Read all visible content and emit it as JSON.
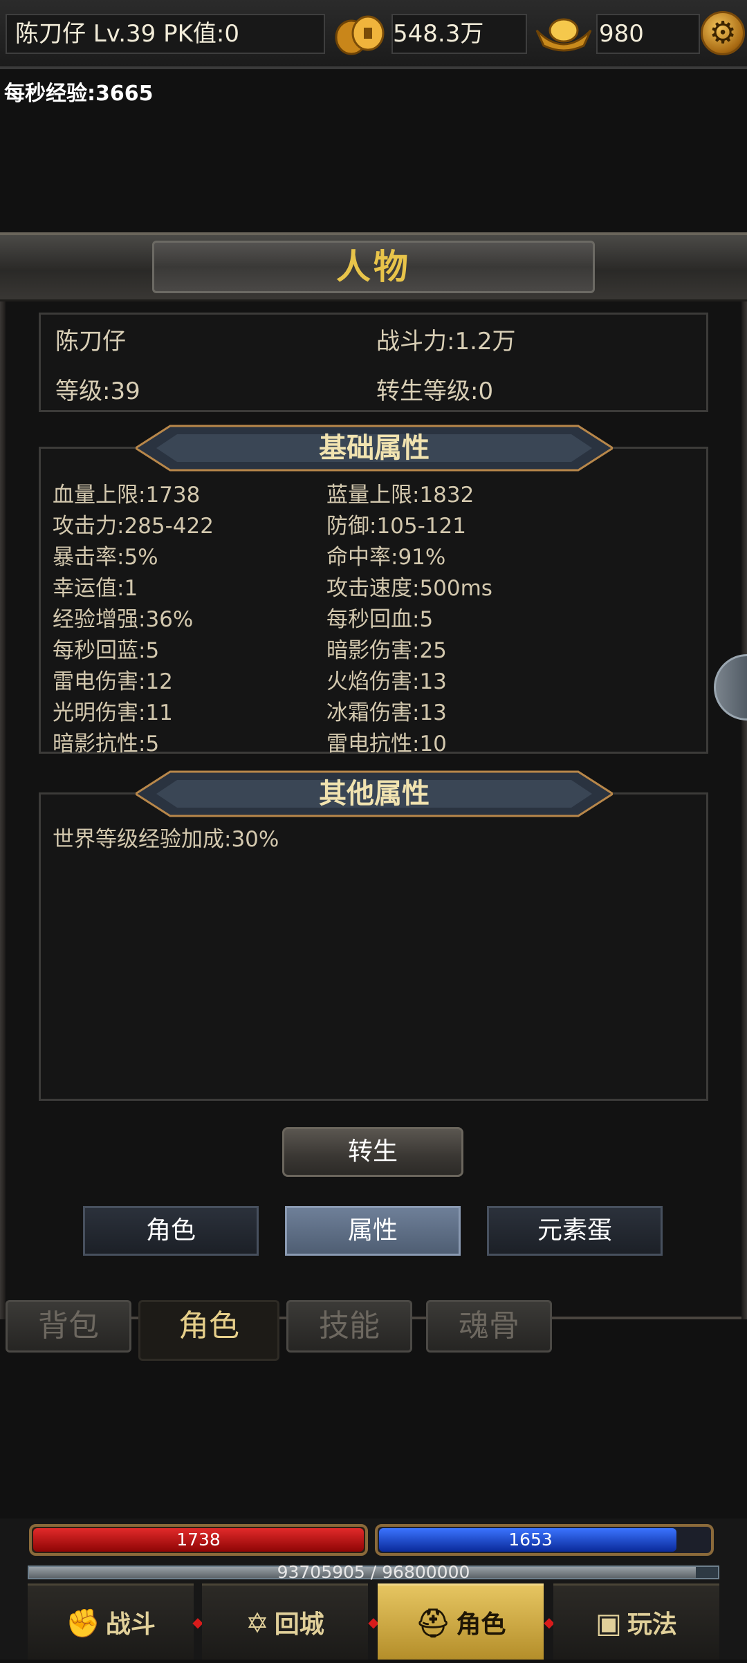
{
  "topbar": {
    "player_info": "陈刀仔  Lv.39 PK值:0",
    "gold": "548.3万",
    "ingot": "980",
    "settings_icon": "gear-icon",
    "coin_icon": "gold-coin-icon",
    "ingot_icon": "gold-ingot-icon"
  },
  "exp_rate": "每秒经验:3665",
  "panel": {
    "title": "人物",
    "character": {
      "name": "陈刀仔",
      "power": "战斗力:1.2万",
      "level": "等级:39",
      "rebirth_level": "转生等级:0"
    },
    "basic_section_title": "基础属性",
    "basic_attrs": [
      "血量上限:1738",
      "蓝量上限:1832",
      "攻击力:285-422",
      "防御:105-121",
      "暴击率:5%",
      "命中率:91%",
      "幸运值:1",
      "攻击速度:500ms",
      "经验增强:36%",
      "每秒回血:5",
      "每秒回蓝:5",
      "暗影伤害:25",
      "雷电伤害:12",
      "火焰伤害:13",
      "光明伤害:11",
      "冰霜伤害:13",
      "暗影抗性:5",
      "雷电抗性:10"
    ],
    "other_section_title": "其他属性",
    "other_attrs": [
      "世界等级经验加成:30%"
    ],
    "rebirth_button": "转生",
    "subtabs": [
      "角色",
      "属性",
      "元素蛋"
    ],
    "active_subtab": "属性"
  },
  "bottom_tabs": [
    "背包",
    "角色",
    "技能",
    "魂骨"
  ],
  "active_bottom_tab": "角色",
  "hud": {
    "hp": "1738",
    "mp": "1653",
    "exp": "93705905 / 96800000",
    "exp_progress": 0.968,
    "mp_progress": 0.9,
    "nav": [
      {
        "label": "战斗",
        "icon": "fist-icon"
      },
      {
        "label": "回城",
        "icon": "portal-icon"
      },
      {
        "label": "角色",
        "icon": "helmet-icon"
      },
      {
        "label": "玩法",
        "icon": "treasure-chest-icon"
      }
    ],
    "active_nav": "角色"
  },
  "colors": {
    "accent_gold": "#e8c44a",
    "hp_red": "#c41010",
    "mp_blue": "#1e4fd8",
    "active_tab": "#5c6b82"
  }
}
